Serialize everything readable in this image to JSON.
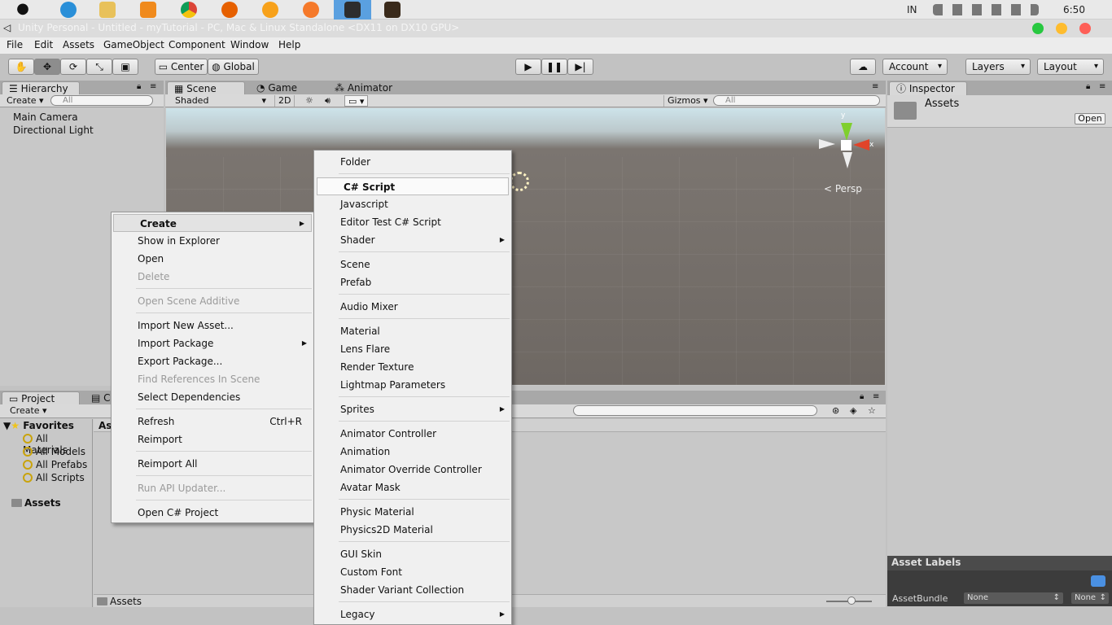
{
  "macbar": {
    "lang": "IN",
    "clock": "6:50"
  },
  "window": {
    "title": "Unity Personal - Untitled - myTutorial - PC, Mac & Linux Standalone <DX11 on DX10 GPU>"
  },
  "menubar": [
    "File",
    "Edit",
    "Assets",
    "GameObject",
    "Component",
    "Window",
    "Help"
  ],
  "toolbar": {
    "center": "Center",
    "global": "Global",
    "account": "Account",
    "layers": "Layers",
    "layout": "Layout"
  },
  "hierarchy": {
    "tab": "Hierarchy",
    "create": "Create",
    "search": "All",
    "items": [
      "Main Camera",
      "Directional Light"
    ]
  },
  "scene": {
    "tabs": [
      "Scene",
      "Game",
      "Animator"
    ],
    "shaded": "Shaded",
    "mode2d": "2D",
    "gizmos": "Gizmos",
    "search": "All",
    "persp": "Persp",
    "axis_y": "y",
    "axis_x": "x"
  },
  "inspector": {
    "tab": "Inspector",
    "title": "Assets",
    "open": "Open",
    "labels": "Asset Labels",
    "bundle": "AssetBundle",
    "none1": "None",
    "none2": "None"
  },
  "project": {
    "tab": "Project",
    "tab2": "Co",
    "create": "Create",
    "favorites": "Favorites",
    "fav_items": [
      "All Materials",
      "All Models",
      "All Prefabs",
      "All Scripts"
    ],
    "assets": "Assets",
    "main_header": "As",
    "footer": "Assets"
  },
  "context_menu": [
    {
      "label": "Create",
      "arrow": true,
      "hl": true
    },
    {
      "label": "Show in Explorer"
    },
    {
      "label": "Open"
    },
    {
      "label": "Delete",
      "disabled": true
    },
    {
      "label": "Open Scene Additive",
      "disabled": true
    },
    {
      "label": "Import New Asset..."
    },
    {
      "label": "Import Package",
      "arrow": true
    },
    {
      "label": "Export Package..."
    },
    {
      "label": "Find References In Scene",
      "disabled": true
    },
    {
      "label": "Select Dependencies"
    },
    {
      "label": "Refresh",
      "shortcut": "Ctrl+R"
    },
    {
      "label": "Reimport"
    },
    {
      "label": "Reimport All"
    },
    {
      "label": "Run API Updater...",
      "disabled": true
    },
    {
      "label": "Open C# Project"
    }
  ],
  "create_submenu": [
    {
      "label": "Folder"
    },
    {
      "label": "C# Script",
      "hl": true
    },
    {
      "label": "Javascript"
    },
    {
      "label": "Editor Test C# Script"
    },
    {
      "label": "Shader",
      "arrow": true
    },
    {
      "label": "Scene"
    },
    {
      "label": "Prefab"
    },
    {
      "label": "Audio Mixer"
    },
    {
      "label": "Material"
    },
    {
      "label": "Lens Flare"
    },
    {
      "label": "Render Texture"
    },
    {
      "label": "Lightmap Parameters"
    },
    {
      "label": "Sprites",
      "arrow": true
    },
    {
      "label": "Animator Controller"
    },
    {
      "label": "Animation"
    },
    {
      "label": "Animator Override Controller"
    },
    {
      "label": "Avatar Mask"
    },
    {
      "label": "Physic Material"
    },
    {
      "label": "Physics2D Material"
    },
    {
      "label": "GUI Skin"
    },
    {
      "label": "Custom Font"
    },
    {
      "label": "Shader Variant Collection"
    },
    {
      "label": "Legacy",
      "arrow": true
    }
  ],
  "icons": [
    "apple-icon",
    "ie-icon",
    "folder-icon",
    "media-icon",
    "chrome-icon",
    "firefox-icon",
    "firefox-alt-icon",
    "blender-icon",
    "unity-icon",
    "film-icon"
  ],
  "colors": {
    "highlight_border": "#bbbbbb",
    "scene_ground": "#6e6863",
    "sky": "#cfe4ec"
  }
}
